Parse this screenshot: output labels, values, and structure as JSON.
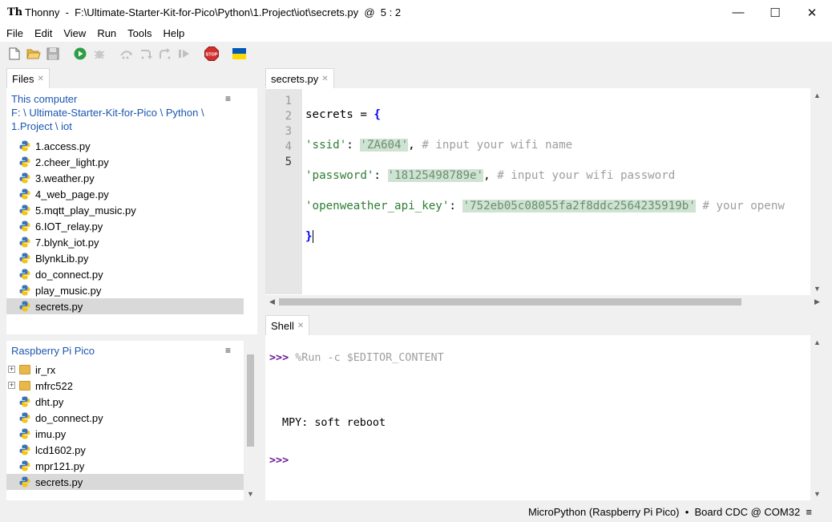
{
  "window": {
    "app_name": "Thonny",
    "title": "Thonny  -  F:\\Ultimate-Starter-Kit-for-Pico\\Python\\1.Project\\iot\\secrets.py  @  5 : 2",
    "min_glyph": "—",
    "max_glyph": "☐",
    "close_glyph": "✕"
  },
  "menubar": [
    "File",
    "Edit",
    "View",
    "Run",
    "Tools",
    "Help"
  ],
  "toolbar": {
    "icons": [
      "new-file-icon",
      "open-file-icon",
      "save-icon",
      "run-icon",
      "debug-icon",
      "step-over-icon",
      "step-into-icon",
      "step-out-icon",
      "resume-icon",
      "stop-icon",
      "ukraine-flag-icon"
    ],
    "stop_label": "STOP",
    "colors": {
      "run": "#2e9e44",
      "stop": "#d32f2f",
      "flag_blue": "#0057b7",
      "flag_yellow": "#ffd700"
    }
  },
  "files_panel": {
    "tab_label": "Files",
    "tab_close": "✕",
    "menu_glyph": "≡",
    "local": {
      "header": "This computer",
      "path_line1": "F: \\ Ultimate-Starter-Kit-for-Pico \\ Python \\",
      "path_line2": "1.Project \\ iot",
      "files": [
        "1.access.py",
        "2.cheer_light.py",
        "3.weather.py",
        "4_web_page.py",
        "5.mqtt_play_music.py",
        "6.IOT_relay.py",
        "7.blynk_iot.py",
        "BlynkLib.py",
        "do_connect.py",
        "play_music.py",
        "secrets.py"
      ],
      "selected": "secrets.py"
    },
    "device": {
      "header": "Raspberry Pi Pico",
      "folders": [
        "ir_rx",
        "mfrc522"
      ],
      "files": [
        "dht.py",
        "do_connect.py",
        "imu.py",
        "lcd1602.py",
        "mpr121.py",
        "secrets.py"
      ],
      "selected": "secrets.py",
      "expander_glyph": "+"
    }
  },
  "editor": {
    "tab_label": "secrets.py",
    "tab_close": "✕",
    "current_line": 5,
    "line_numbers": [
      "1",
      "2",
      "3",
      "4",
      "5"
    ],
    "lines": {
      "l1_text": "secrets = ",
      "l1_brace": "{",
      "l2_key": "'ssid'",
      "l2_sep": ": ",
      "l2_val": "'ZA604'",
      "l2_comma": ", ",
      "l2_comment": "# input your wifi name",
      "l3_key": "'password'",
      "l3_sep": ": ",
      "l3_val": "'18125498789e'",
      "l3_comma": ", ",
      "l3_comment": "# input your wifi password",
      "l4_key": "'openweather_api_key'",
      "l4_sep": ": ",
      "l4_val": "'752eb05c08055fa2f8ddc2564235919b'",
      "l4_comment": " # your openw",
      "l5_brace": "}"
    }
  },
  "shell": {
    "tab_label": "Shell",
    "tab_close": "✕",
    "prompt": ">>>",
    "command": " %Run -c $EDITOR_CONTENT",
    "output": " MPY: soft reboot",
    "prompt2": ">>>"
  },
  "statusbar": {
    "text": "MicroPython (Raspberry Pi Pico)  •  Board CDC @ COM32  ≡"
  },
  "scroll_glyphs": {
    "up": "▲",
    "down": "▼",
    "left": "◀",
    "right": "▶"
  }
}
